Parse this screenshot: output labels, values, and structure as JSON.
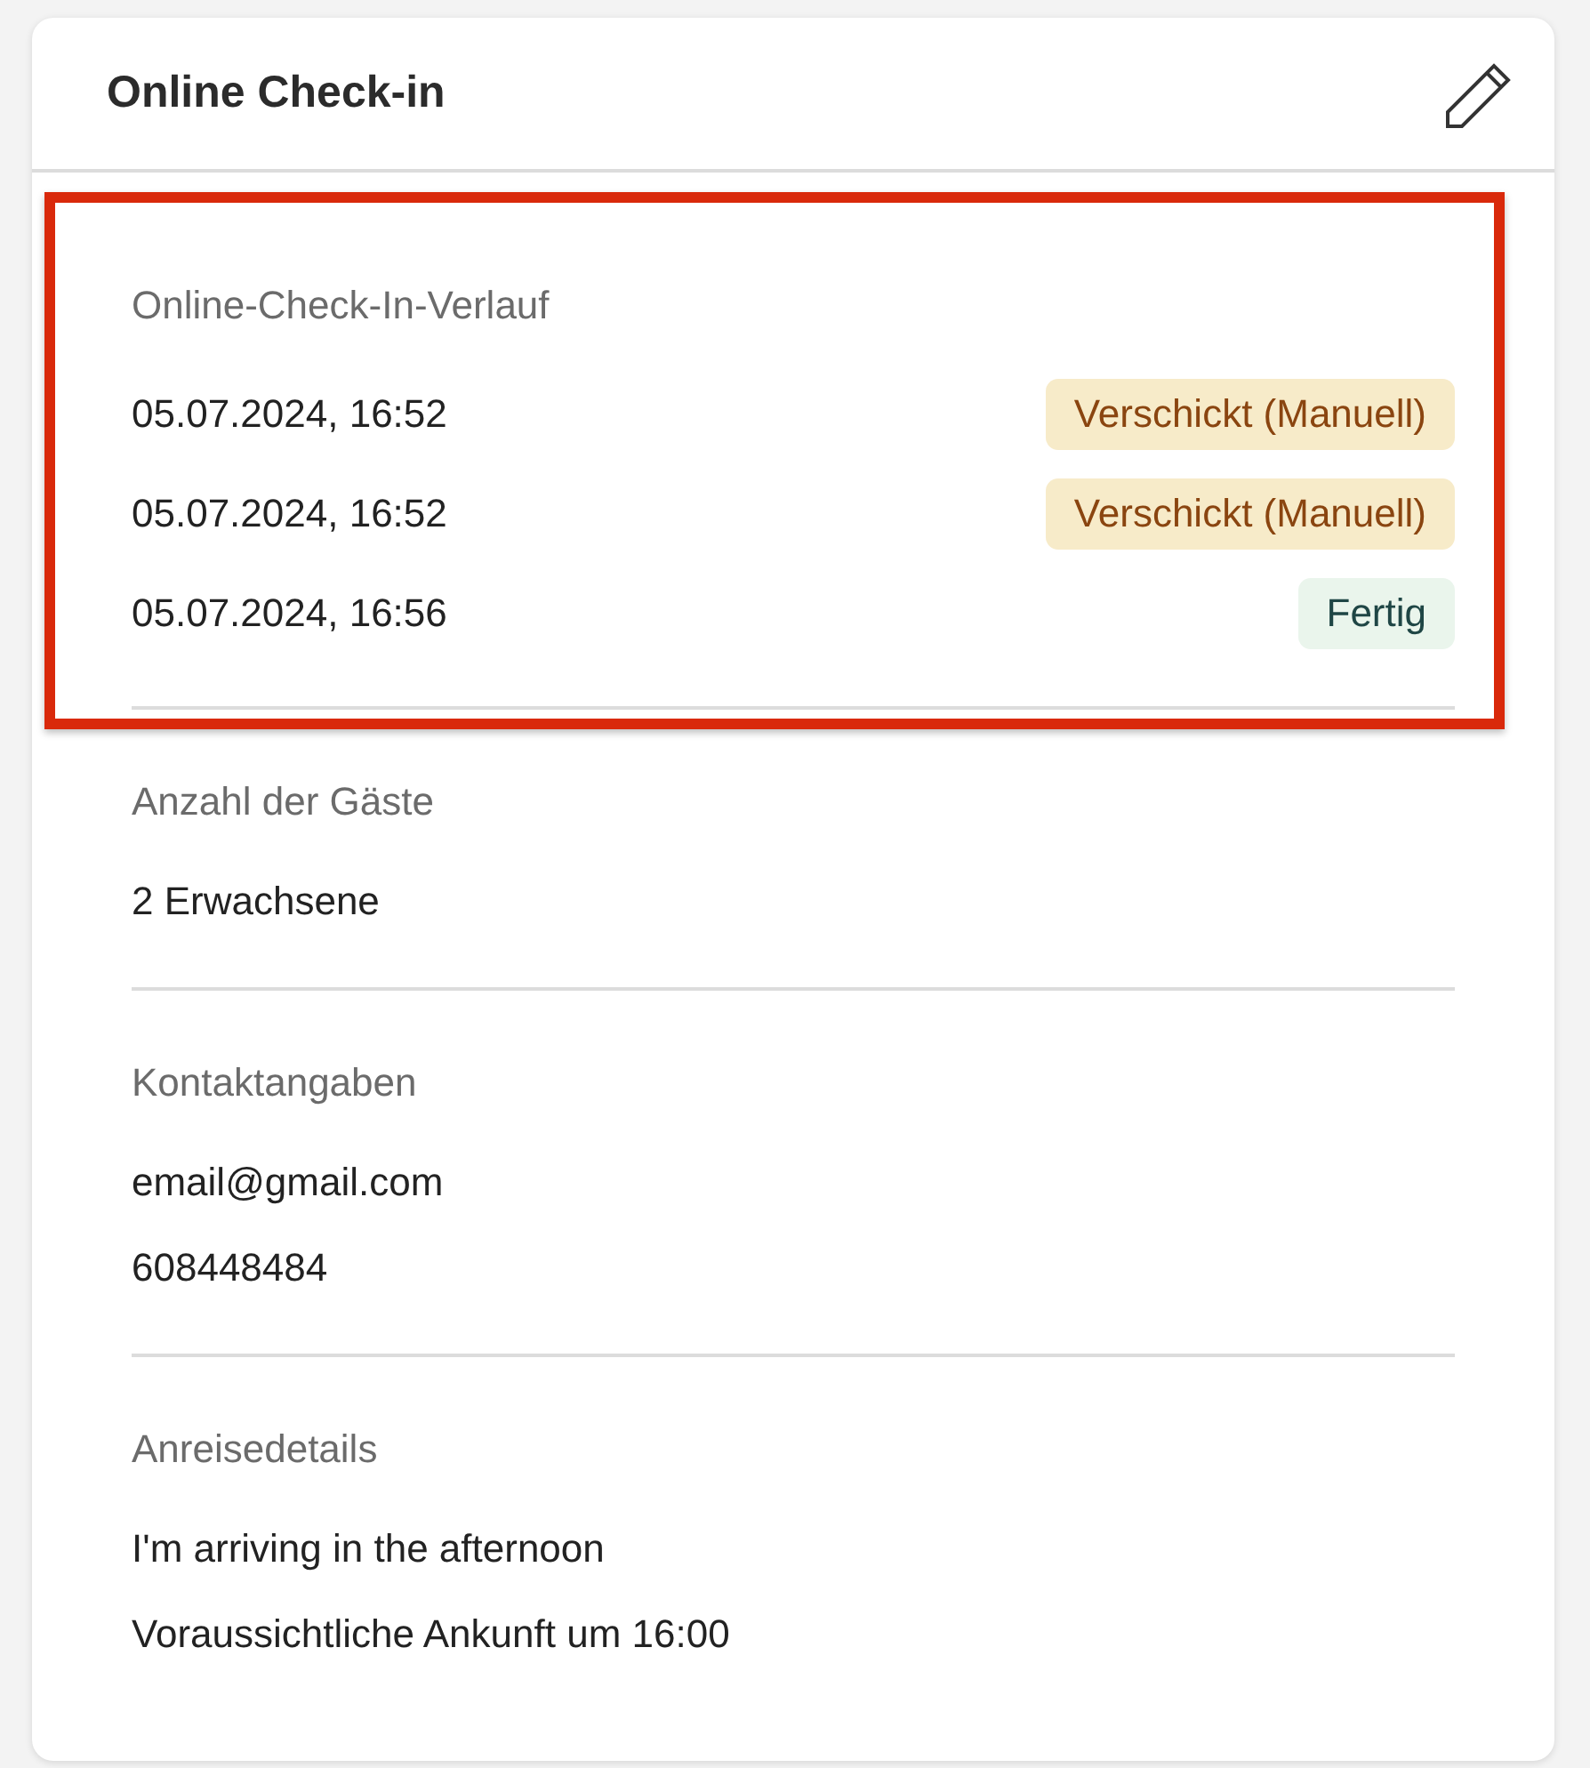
{
  "card": {
    "title": "Online Check-in"
  },
  "sections": [
    {
      "label": "Online-Check-In-Verlauf",
      "highlighted": true,
      "kind": "history",
      "entries": [
        {
          "time": "05.07.2024, 16:52",
          "status": "Verschickt (Manuell)",
          "kind": "sent"
        },
        {
          "time": "05.07.2024, 16:52",
          "status": "Verschickt (Manuell)",
          "kind": "sent"
        },
        {
          "time": "05.07.2024, 16:56",
          "status": "Fertig",
          "kind": "done"
        }
      ]
    },
    {
      "label": "Anzahl der Gäste",
      "highlighted": false,
      "kind": "values",
      "values": [
        "2 Erwachsene"
      ]
    },
    {
      "label": "Kontaktangaben",
      "highlighted": false,
      "kind": "values",
      "values": [
        "email@gmail.com",
        "608448484"
      ]
    },
    {
      "label": "Anreisedetails",
      "highlighted": false,
      "kind": "values",
      "values": [
        "I'm arriving in the afternoon",
        "Voraussichtliche Ankunft um 16:00"
      ]
    }
  ]
}
